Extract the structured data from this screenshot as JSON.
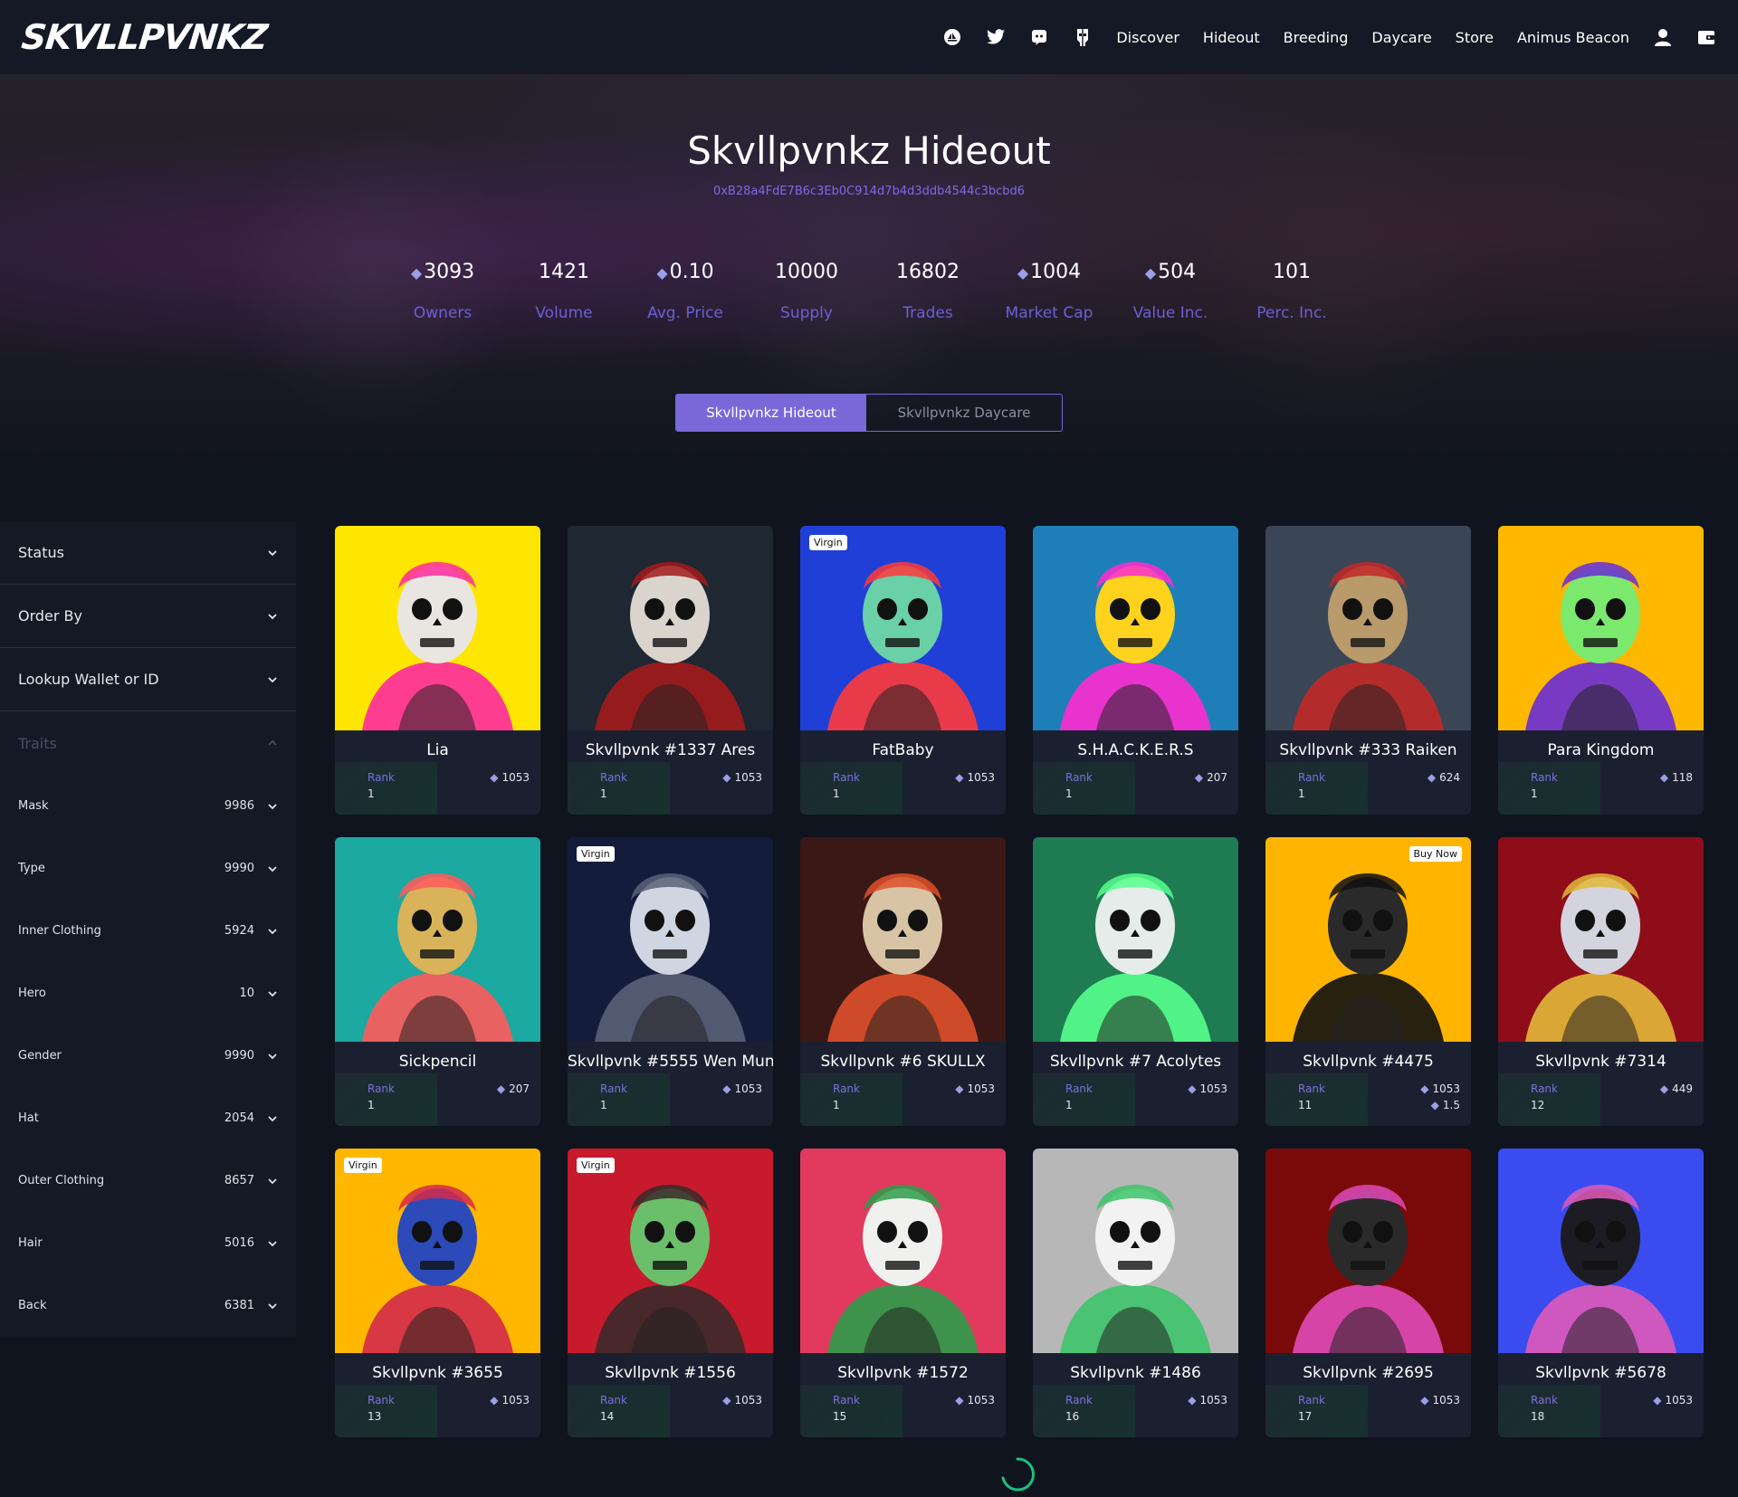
{
  "nav": {
    "logo": "SKVLLPVNKZ",
    "links": [
      "Discover",
      "Hideout",
      "Breeding",
      "Daycare",
      "Store",
      "Animus Beacon"
    ]
  },
  "hero": {
    "title": "Skvllpvnkz Hideout",
    "address": "0xB28a4FdE7B6c3Eb0C914d7b4d3ddb4544c3bcbd6",
    "stats": [
      {
        "value": "3093",
        "label": "Owners",
        "eth": true
      },
      {
        "value": "1421",
        "label": "Volume",
        "eth": false
      },
      {
        "value": "0.10",
        "label": "Avg. Price",
        "eth": true
      },
      {
        "value": "10000",
        "label": "Supply",
        "eth": false
      },
      {
        "value": "16802",
        "label": "Trades",
        "eth": false
      },
      {
        "value": "1004",
        "label": "Market Cap",
        "eth": true
      },
      {
        "value": "504",
        "label": "Value Inc.",
        "eth": true
      },
      {
        "value": "101",
        "label": "Perc. Inc.",
        "eth": false
      }
    ],
    "tabs": {
      "active": "Skvllpvnkz Hideout",
      "inactive": "Skvllpvnkz Daycare"
    }
  },
  "sidebar": {
    "status": "Status",
    "order_by": "Order By",
    "lookup": "Lookup Wallet or ID",
    "traits_title": "Traits",
    "traits": [
      {
        "name": "Mask",
        "count": "9986"
      },
      {
        "name": "Type",
        "count": "9990"
      },
      {
        "name": "Inner Clothing",
        "count": "5924"
      },
      {
        "name": "Hero",
        "count": "10"
      },
      {
        "name": "Gender",
        "count": "9990"
      },
      {
        "name": "Hat",
        "count": "2054"
      },
      {
        "name": "Outer Clothing",
        "count": "8657"
      },
      {
        "name": "Hair",
        "count": "5016"
      },
      {
        "name": "Back",
        "count": "6381"
      }
    ]
  },
  "rank_label": "Rank",
  "cards": [
    {
      "name": "Lia",
      "rank": "1",
      "price": "1053",
      "price2": "",
      "badge": "",
      "bg": "#ffe600",
      "face": "#e9e6e1",
      "accent": "#ff2aa0"
    },
    {
      "name": "Skvllpvnk #1337 Ares",
      "rank": "1",
      "price": "1053",
      "price2": "",
      "badge": "",
      "bg": "#1e2732",
      "face": "#d9d4cc",
      "accent": "#a21b1b"
    },
    {
      "name": "FatBaby",
      "rank": "1",
      "price": "1053",
      "price2": "",
      "badge": "Virgin",
      "bg": "#1f3fd6",
      "face": "#6ad0a8",
      "accent": "#ff3a3a"
    },
    {
      "name": "S.H.A.C.K.E.R.S",
      "rank": "1",
      "price": "207",
      "price2": "",
      "badge": "",
      "bg": "#1e7fb8",
      "face": "#ffd21e",
      "accent": "#ff2bd0"
    },
    {
      "name": "Skvllpvnk #333 Raiken",
      "rank": "1",
      "price": "624",
      "price2": "",
      "badge": "",
      "bg": "#3a4656",
      "face": "#b89a6b",
      "accent": "#c22828"
    },
    {
      "name": "Para Kingdom",
      "rank": "1",
      "price": "118",
      "price2": "",
      "badge": "",
      "bg": "#ffb800",
      "face": "#7be86e",
      "accent": "#6a2cd8"
    },
    {
      "name": "Sickpencil",
      "rank": "1",
      "price": "207",
      "price2": "",
      "badge": "",
      "bg": "#1ba9a2",
      "face": "#d8b35a",
      "accent": "#ff5a5a"
    },
    {
      "name": "Skvllpvnk #5555 Wen Mun",
      "rank": "1",
      "price": "1053",
      "price2": "",
      "badge": "Virgin",
      "bg": "#141c3c",
      "face": "#cfd6e2",
      "accent": "#596277"
    },
    {
      "name": "Skvllpvnk #6 SKULLX",
      "rank": "1",
      "price": "1053",
      "price2": "",
      "badge": "",
      "bg": "#3a1816",
      "face": "#d8c4a4",
      "accent": "#e0502a"
    },
    {
      "name": "Skvllpvnk #7 Acolytes",
      "rank": "1",
      "price": "1053",
      "price2": "",
      "badge": "",
      "bg": "#1e7b52",
      "face": "#e6ecea",
      "accent": "#56ff8c"
    },
    {
      "name": "Skvllpvnk #4475",
      "rank": "11",
      "price": "1053",
      "price2": "1.5",
      "badge": "Buy Now",
      "bg": "#ffb500",
      "face": "#2a2a2a",
      "accent": "#111111"
    },
    {
      "name": "Skvllpvnk #7314",
      "rank": "12",
      "price": "449",
      "price2": "",
      "badge": "",
      "bg": "#8e0d18",
      "face": "#d4d4de",
      "accent": "#e2b83a"
    },
    {
      "name": "Skvllpvnk #3655",
      "rank": "13",
      "price": "1053",
      "price2": "",
      "badge": "Virgin",
      "bg": "#ffb700",
      "face": "#2c4ab8",
      "accent": "#d42a4a"
    },
    {
      "name": "Skvllpvnk #1556",
      "rank": "14",
      "price": "1053",
      "price2": "",
      "badge": "Virgin",
      "bg": "#c71a2c",
      "face": "#6bbf6a",
      "accent": "#3a2a2a"
    },
    {
      "name": "Skvllpvnk #1572",
      "rank": "15",
      "price": "1053",
      "price2": "",
      "badge": "",
      "bg": "#e23a5e",
      "face": "#f0f0ee",
      "accent": "#2e9c4a"
    },
    {
      "name": "Skvllpvnk #1486",
      "rank": "16",
      "price": "1053",
      "price2": "",
      "badge": "",
      "bg": "#b7b7b7",
      "face": "#f2f2f2",
      "accent": "#3ec46a"
    },
    {
      "name": "Skvllpvnk #2695",
      "rank": "17",
      "price": "1053",
      "price2": "",
      "badge": "",
      "bg": "#7a0a0a",
      "face": "#2a2a2a",
      "accent": "#e04ab8"
    },
    {
      "name": "Skvllpvnk #5678",
      "rank": "18",
      "price": "1053",
      "price2": "",
      "badge": "",
      "bg": "#3a4cf0",
      "face": "#1c1c22",
      "accent": "#e05ab8"
    }
  ]
}
